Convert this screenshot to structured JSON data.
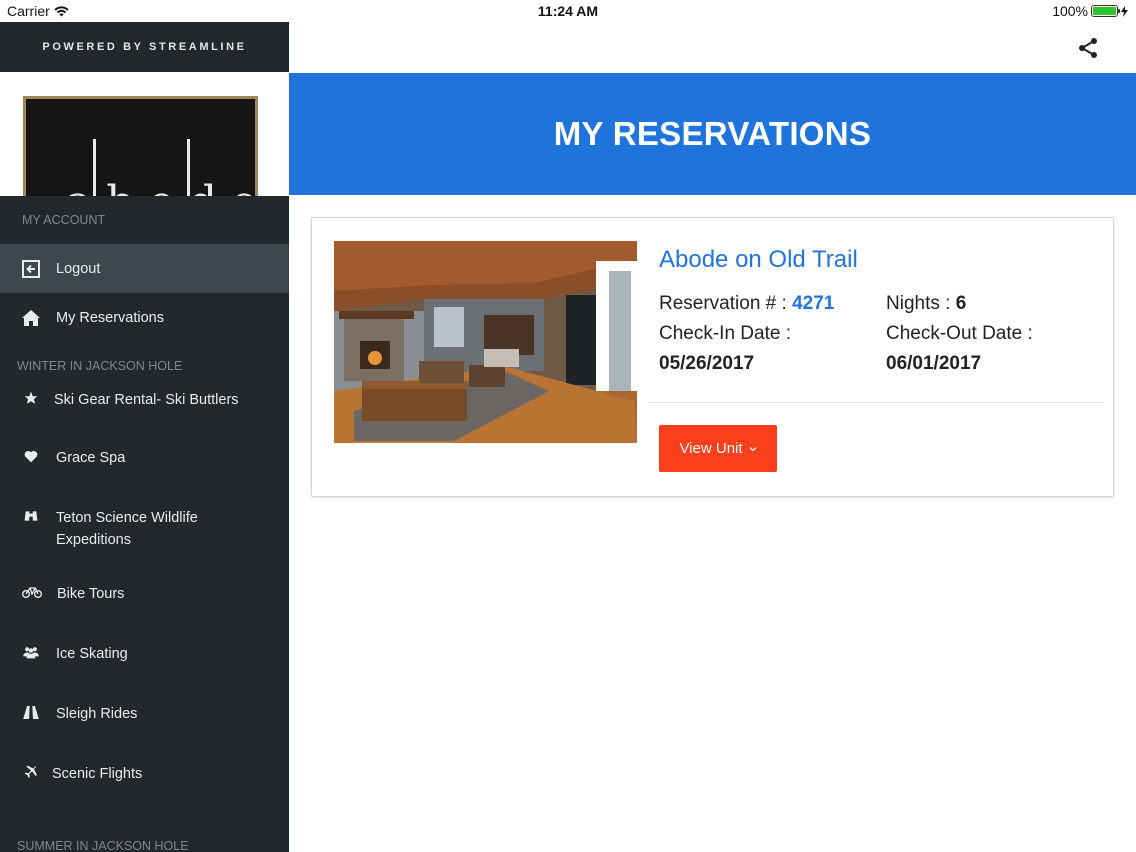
{
  "status_bar": {
    "carrier": "Carrier",
    "time": "11:24 AM",
    "battery": "100%"
  },
  "sidebar": {
    "powered_by": "POWERED BY STREAMLINE",
    "logo_text": "abode",
    "sections": [
      {
        "header": "MY ACCOUNT"
      },
      {
        "header": "WINTER IN JACKSON HOLE"
      },
      {
        "header": "SUMMER IN JACKSON HOLE"
      }
    ],
    "account_items": [
      {
        "label": "Logout",
        "icon": "logout-icon"
      },
      {
        "label": "My Reservations",
        "icon": "home-icon"
      }
    ],
    "winter_items": [
      {
        "label": "Ski Gear Rental- Ski Buttlers",
        "icon": "star-icon"
      },
      {
        "label": "Grace Spa",
        "icon": "heart-icon"
      },
      {
        "label": "Teton Science Wildlife Expeditions",
        "icon": "binoculars-icon"
      },
      {
        "label": "Bike Tours",
        "icon": "bicycle-icon"
      },
      {
        "label": "Ice Skating",
        "icon": "group-icon"
      },
      {
        "label": "Sleigh Rides",
        "icon": "road-icon"
      },
      {
        "label": "Scenic Flights",
        "icon": "plane-icon"
      }
    ]
  },
  "header": {
    "title": "MY RESERVATIONS",
    "share_icon": "share-icon"
  },
  "reservation": {
    "property_name": "Abode on Old Trail",
    "reservation_label": "Reservation # :",
    "reservation_number": "4271",
    "nights_label": "Nights :",
    "nights": "6",
    "checkin_label": "Check-In Date :",
    "checkin_date": "05/26/2017",
    "checkout_label": "Check-Out Date :",
    "checkout_date": "06/01/2017",
    "view_button": "View Unit",
    "accent_color": "#1f74dc",
    "button_color": "#fa3f1d"
  }
}
